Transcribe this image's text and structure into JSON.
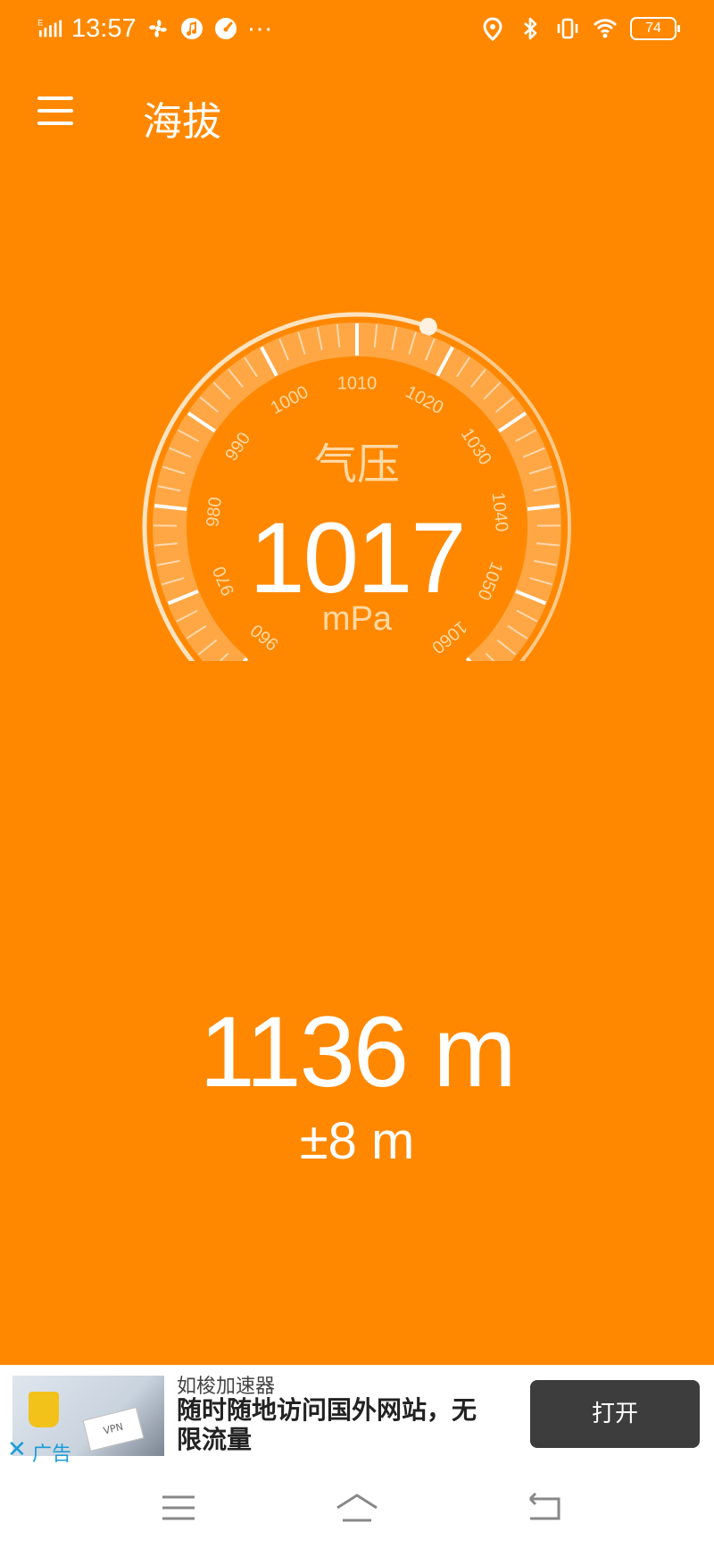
{
  "status_bar": {
    "network_indicator": "E",
    "time": "13:57",
    "more": "···",
    "battery": "74",
    "left_icons": [
      "fan-icon",
      "music-icon",
      "speedometer-icon"
    ],
    "right_icons": [
      "location-icon",
      "bluetooth-icon",
      "vibrate-icon",
      "wifi-icon",
      "battery-icon"
    ]
  },
  "app_bar": {
    "title": "海拔",
    "menu_icon": "hamburger-menu-icon"
  },
  "gauge": {
    "title": "气压",
    "value": "1017",
    "unit": "mPa",
    "value_num": 1017,
    "min": 960,
    "max": 1060,
    "tick_labels": [
      "960",
      "970",
      "980",
      "990",
      "1000",
      "1010",
      "1020",
      "1030",
      "1040",
      "1050",
      "1060"
    ],
    "accent_color": "#ff8800"
  },
  "altitude": {
    "value": "1136 m",
    "accuracy": "±8 m"
  },
  "ad": {
    "brand": "如梭加速器",
    "text": "随时随地访问国外网站，无限流量",
    "button": "打开",
    "tag": "广告",
    "close_icon": "close-icon",
    "image_caption": "VPN"
  },
  "nav_bar": {
    "icons": [
      "menu-icon",
      "home-icon",
      "back-icon"
    ]
  }
}
